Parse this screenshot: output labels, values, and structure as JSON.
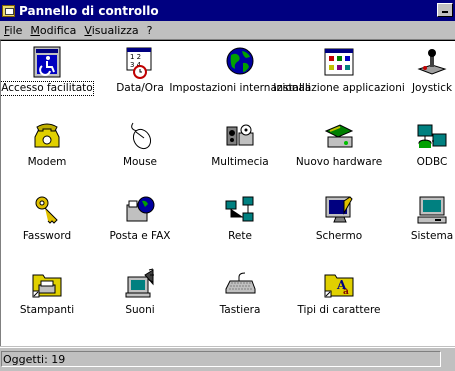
{
  "window": {
    "title": "Pannello di controllo"
  },
  "menu": {
    "items": [
      {
        "label": "File"
      },
      {
        "label": "Modifica"
      },
      {
        "label": "Visualizza"
      },
      {
        "label": "?"
      }
    ]
  },
  "icons": [
    {
      "label": "Accesso facilitato",
      "icon": "accessibility-icon",
      "selected": true
    },
    {
      "label": "Data/Ora",
      "icon": "calendar-clock-icon"
    },
    {
      "label": "Impostazioni internazionali",
      "icon": "globe-icon"
    },
    {
      "label": "Installazione applicazioni",
      "icon": "install-apps-icon"
    },
    {
      "label": "Joystick",
      "icon": "joystick-icon"
    },
    {
      "label": "Modem",
      "icon": "modem-phone-icon"
    },
    {
      "label": "Mouse",
      "icon": "mouse-icon"
    },
    {
      "label": "Multimecia",
      "icon": "multimedia-icon"
    },
    {
      "label": "Nuovo hardware",
      "icon": "new-hardware-icon"
    },
    {
      "label": "ODBC",
      "icon": "odbc-icon"
    },
    {
      "label": "Fassword",
      "icon": "password-keys-icon"
    },
    {
      "label": "Posta e FAX",
      "icon": "mail-fax-icon"
    },
    {
      "label": "Rete",
      "icon": "network-icon"
    },
    {
      "label": "Schermo",
      "icon": "display-icon"
    },
    {
      "label": "Sistema",
      "icon": "system-computer-icon"
    },
    {
      "label": "Stampanti",
      "icon": "printers-folder-icon"
    },
    {
      "label": "Suoni",
      "icon": "sounds-icon"
    },
    {
      "label": "Tastiera",
      "icon": "keyboard-icon"
    },
    {
      "label": "Tipi di carattere",
      "icon": "fonts-folder-icon"
    }
  ],
  "statusbar": {
    "text": "Oggetti: 19"
  }
}
